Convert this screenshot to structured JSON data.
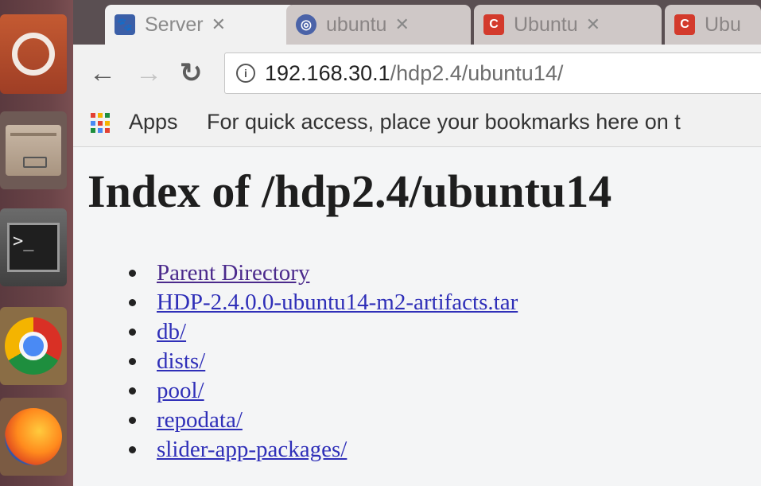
{
  "tabs": [
    {
      "title": "Server",
      "favicon": "paw-icon",
      "color": "#3b5fa8",
      "active": true
    },
    {
      "title": "ubuntu",
      "favicon": "globe-icon",
      "color": "#4b63a8",
      "active": false
    },
    {
      "title": "Ubuntu",
      "favicon": "c-logo-icon",
      "color": "#d33a2c",
      "active": false
    },
    {
      "title": "Ubu",
      "favicon": "c-logo-icon",
      "color": "#d33a2c",
      "active": false
    }
  ],
  "toolbar": {
    "url_host": "192.168.30.1",
    "url_path": "/hdp2.4/ubuntu14/"
  },
  "bookmarks": {
    "apps_label": "Apps",
    "hint": "For quick access, place your bookmarks here on t"
  },
  "page": {
    "heading": "Index of /hdp2.4/ubuntu14",
    "links": [
      {
        "label": "Parent Directory",
        "visited": true
      },
      {
        "label": "HDP-2.4.0.0-ubuntu14-m2-artifacts.tar",
        "visited": false
      },
      {
        "label": "db/",
        "visited": false
      },
      {
        "label": "dists/",
        "visited": false
      },
      {
        "label": "pool/",
        "visited": false
      },
      {
        "label": "repodata/",
        "visited": false
      },
      {
        "label": "slider-app-packages/",
        "visited": false
      }
    ]
  },
  "colors": {
    "link": "#2f2fb8",
    "visited_link": "#4b2a8c"
  }
}
